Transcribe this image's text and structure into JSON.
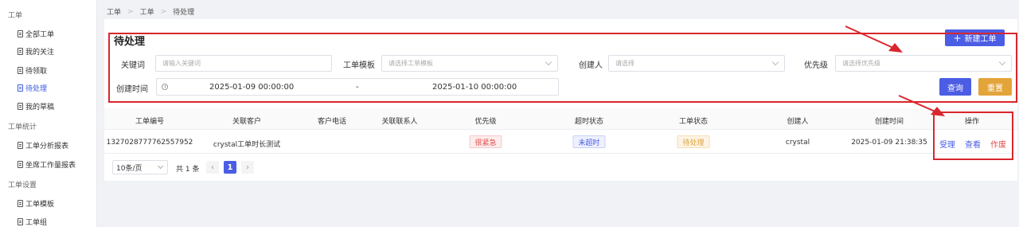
{
  "sidebar": {
    "groups": [
      "工单",
      "工单统计",
      "工单设置"
    ],
    "items": [
      {
        "label": "全部工单",
        "active": false
      },
      {
        "label": "我的关注",
        "active": false
      },
      {
        "label": "待领取",
        "active": false
      },
      {
        "label": "待处理",
        "active": true
      },
      {
        "label": "我的草稿",
        "active": false
      },
      {
        "label": "工单分析报表",
        "active": false
      },
      {
        "label": "坐席工作量报表",
        "active": false
      },
      {
        "label": "工单模板",
        "active": false
      },
      {
        "label": "工单组",
        "active": false
      }
    ]
  },
  "breadcrumb": [
    "工单",
    "工单",
    "待处理"
  ],
  "page_title": "待处理",
  "buttons": {
    "new": "新建工单",
    "query": "查询",
    "reset": "重置"
  },
  "filters": {
    "keyword": {
      "label": "关键词",
      "placeholder": "请输入关键词"
    },
    "template": {
      "label": "工单模板",
      "placeholder": "请选择工单模板"
    },
    "creator": {
      "label": "创建人",
      "placeholder": "请选择"
    },
    "priority": {
      "label": "优先级",
      "placeholder": "请选择优先级"
    },
    "created_time": {
      "label": "创建时间",
      "start": "2025-01-09 00:00:00",
      "separator": "-",
      "end": "2025-01-10 00:00:00"
    }
  },
  "table": {
    "headers": [
      "工单编号",
      "关联客户",
      "客户电话",
      "关联联系人",
      "优先级",
      "超时状态",
      "工单状态",
      "创建人",
      "创建时间",
      "操作"
    ],
    "rows": [
      {
        "id": "1327028777762557952",
        "customer": "crystal工单时长测试",
        "phone": "",
        "contact": "",
        "priority": "很紧急",
        "timeout": "未超时",
        "status": "待处理",
        "creator": "crystal",
        "created": "2025-01-09 21:38:35",
        "actions": [
          "受理",
          "查看",
          "作废"
        ]
      }
    ]
  },
  "pagination": {
    "page_size": "10条/页",
    "total": "共 1 条",
    "current": "1",
    "prev": "‹",
    "next": "›"
  },
  "colors": {
    "primary": "#4b5de4",
    "warning": "#e3a43a",
    "danger": "#e44d4d",
    "annotation": "#d9262d"
  }
}
